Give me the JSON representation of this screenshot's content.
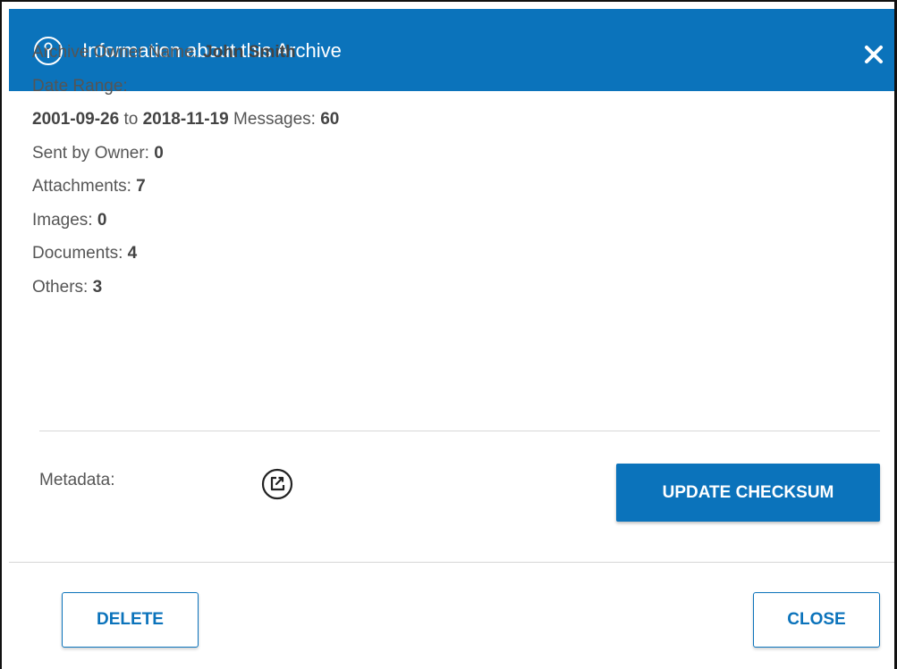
{
  "dialog": {
    "title": "Information about this Archive",
    "header_color": "#0b73bb",
    "icons": {
      "info": "info-circle-icon",
      "close": "close-icon",
      "edit": "edit-square-icon"
    }
  },
  "info": {
    "owner_label": "Archive Owner Name: ",
    "owner_value": "John Smith",
    "date_range_label": "Date Range:",
    "date_start": "2001-09-26",
    "date_to": " to ",
    "date_end": "2018-11-19",
    "messages_label": " Messages: ",
    "messages_value": "60",
    "sent_label": "Sent by Owner: ",
    "sent_value": "0",
    "attachments_label": "Attachments: ",
    "attachments_value": "7",
    "images_label": "Images: ",
    "images_value": "0",
    "documents_label": "Documents: ",
    "documents_value": "4",
    "others_label": "Others: ",
    "others_value": "3"
  },
  "metadata": {
    "label": "Metadata:"
  },
  "buttons": {
    "update_checksum": "UPDATE CHECKSUM",
    "delete": "DELETE",
    "close": "CLOSE"
  }
}
